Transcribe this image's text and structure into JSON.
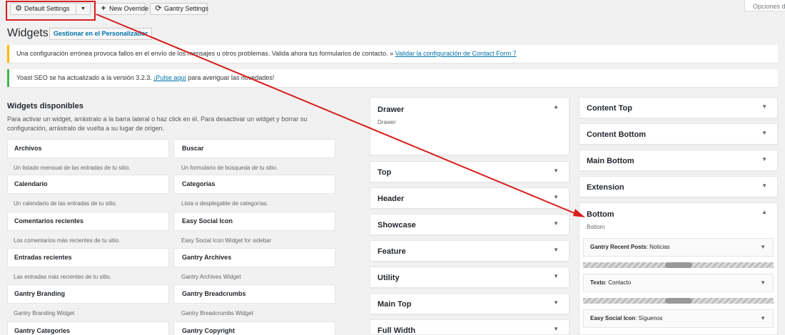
{
  "toolbar": {
    "default_settings": "Default Settings",
    "dropdown_caret": "▼",
    "new_override": "New Override",
    "gantry_settings": "Gantry Settings",
    "screen_options": "Opciones de"
  },
  "header": {
    "title": "Widgets",
    "manage_link": "Gestionar en el Personalizador"
  },
  "notices": {
    "cf7_text": "Una configuración errónea provoca fallos en el envío de los mensajes u otros problemas. Valida ahora tus formularios de contacto. »",
    "cf7_link": "Validar la configuración de Contact Form 7",
    "yoast_text_1": "Yoast SEO se ha actualizado a la versión 3.2.3.",
    "yoast_link": "¡Pulse aquí",
    "yoast_text_2": "para averiguar las novedades!"
  },
  "available": {
    "title": "Widgets disponibles",
    "description": "Para activar un widget, arrástralo a la barra lateral o haz click en él. Para desactivar un widget y borrar su configuración, arrástralo de vuelta a su lugar de origen.",
    "widgets": [
      {
        "name": "Archivos",
        "desc": "Un listado mensual de las entradas de tu sitio."
      },
      {
        "name": "Buscar",
        "desc": "Un formulario de búsqueda de tu sitio."
      },
      {
        "name": "Calendario",
        "desc": "Un calendario de las entradas de tu sitio."
      },
      {
        "name": "Categorías",
        "desc": "Lista o desplegable de categorías."
      },
      {
        "name": "Comentarios recientes",
        "desc": "Los comentarios más recientes de tu sitio."
      },
      {
        "name": "Easy Social Icon",
        "desc": "Easy Social Icon Widget for sidebar"
      },
      {
        "name": "Entradas recientes",
        "desc": "Las entradas más recientes de tu sitio."
      },
      {
        "name": "Gantry Archives",
        "desc": "Gantry Archives Widget"
      },
      {
        "name": "Gantry Branding",
        "desc": "Gantry Branding Widget"
      },
      {
        "name": "Gantry Breadcrumbs",
        "desc": "Gantry Breadcrumbs Widget"
      },
      {
        "name": "Gantry Categories",
        "desc": ""
      },
      {
        "name": "Gantry Copyright",
        "desc": ""
      }
    ]
  },
  "areas_mid": {
    "drawer": {
      "label": "Drawer",
      "sub": "Drawer",
      "arrow": "▲"
    },
    "top": "Top",
    "header": "Header",
    "showcase": "Showcase",
    "feature": "Feature",
    "utility": "Utility",
    "main_top": "Main Top",
    "full_width": "Full Width",
    "arrow_down": "▼"
  },
  "areas_right": {
    "content_top": "Content Top",
    "content_bottom": "Content Bottom",
    "main_bottom": "Main Bottom",
    "extension": "Extension",
    "bottom": {
      "label": "Bottom",
      "sub": "Bottom",
      "arrow": "▲"
    },
    "bottom_widgets": [
      {
        "name": "Gantry Recent Posts",
        "title": ": Noticias"
      },
      {
        "name": "Texto",
        "title": ": Contacto"
      },
      {
        "name": "Easy Social Icon",
        "title": ": Síguenos"
      }
    ]
  },
  "colors": {
    "annotation": "#d71d1d",
    "link": "#0073aa",
    "notice_warning": "#ffb900",
    "notice_success": "#46b450"
  }
}
